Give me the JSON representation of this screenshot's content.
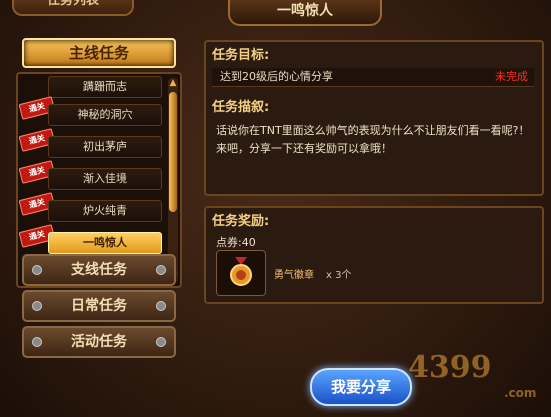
{
  "window": {
    "corner_tab": "任务列表",
    "title": "一鸣惊人"
  },
  "left": {
    "main_header": "主线任务",
    "tasks": [
      {
        "name": "蹒跚而志",
        "badge": ""
      },
      {
        "name": "神秘的洞穴",
        "badge": "通关"
      },
      {
        "name": "初出茅庐",
        "badge": "通关"
      },
      {
        "name": "渐入佳境",
        "badge": "通关"
      },
      {
        "name": "炉火纯青",
        "badge": "通关"
      },
      {
        "name": "一鸣惊人",
        "badge": "通关",
        "active": true
      }
    ],
    "categories": [
      "支线任务",
      "日常任务",
      "活动任务"
    ]
  },
  "goal": {
    "header": "任务目标:",
    "text": "达到20级后的心情分享",
    "status": "未完成",
    "status_color": "#ff3020"
  },
  "description": {
    "header": "任务描叙:",
    "text": "话说你在TNT里面这么帅气的表现为什么不让朋友们看一看呢?！来吧，分享一下还有奖励可以拿哦！"
  },
  "reward": {
    "header": "任务奖励:",
    "coupon": "点券:40",
    "item_name": "勇气徽章",
    "item_qty": "x 3个"
  },
  "share_button": "我要分享",
  "logo": {
    "main": "4399",
    "sub": ".com"
  }
}
